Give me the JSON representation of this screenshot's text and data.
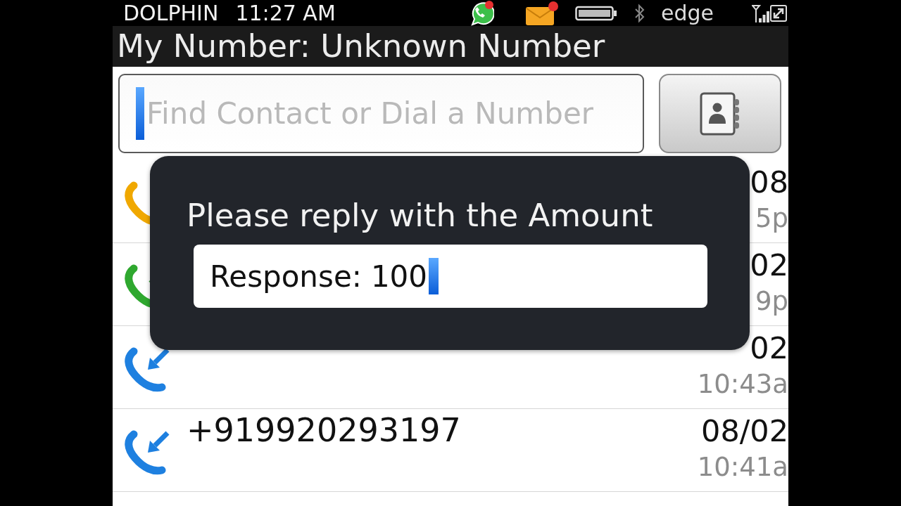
{
  "status_bar": {
    "carrier": "DOLPHIN",
    "time": "11:27 AM",
    "network": "edge"
  },
  "header": {
    "title": "My Number: Unknown Number"
  },
  "search": {
    "placeholder": "Find Contact or Dial a Number"
  },
  "call_log": [
    {
      "kind": "missed",
      "date": "08",
      "time": "5p"
    },
    {
      "kind": "outgoing",
      "date": "02",
      "time": "9p"
    },
    {
      "kind": "incoming",
      "date": "02",
      "time": "10:43a"
    },
    {
      "kind": "incoming",
      "number": "+919920293197",
      "date": "08/02",
      "time": "10:41a"
    }
  ],
  "dialog": {
    "prompt": "Please reply with the Amount",
    "field": {
      "label": "Response:",
      "value": "100"
    }
  }
}
